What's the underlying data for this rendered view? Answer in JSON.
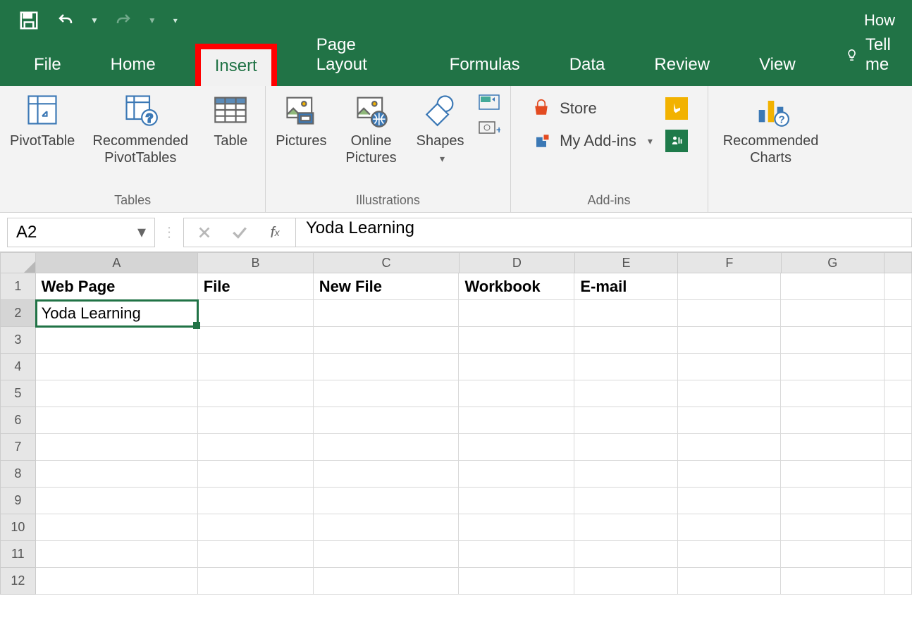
{
  "titlebar": {
    "right_text": "How"
  },
  "tabs": {
    "file": "File",
    "home": "Home",
    "insert": "Insert",
    "page_layout": "Page Layout",
    "formulas": "Formulas",
    "data": "Data",
    "review": "Review",
    "view": "View",
    "tell_me": "Tell me",
    "active": "Insert"
  },
  "ribbon": {
    "tables": {
      "pivottable": "PivotTable",
      "recommended": "Recommended PivotTables",
      "table": "Table",
      "group_label": "Tables"
    },
    "illustrations": {
      "pictures": "Pictures",
      "online_pictures": "Online Pictures",
      "shapes": "Shapes",
      "group_label": "Illustrations"
    },
    "addins": {
      "store": "Store",
      "my_addins": "My Add-ins",
      "group_label": "Add-ins"
    },
    "charts": {
      "recommended_charts": "Recommended Charts"
    }
  },
  "namebox": "A2",
  "formula": "Yoda Learning",
  "columns": [
    "A",
    "B",
    "C",
    "D",
    "E",
    "F",
    "G"
  ],
  "row_count": 12,
  "cells": {
    "A1": "Web Page",
    "B1": "File",
    "C1": "New File",
    "D1": "Workbook",
    "E1": "E-mail",
    "A2": "Yoda Learning"
  },
  "selected_cell": "A2"
}
